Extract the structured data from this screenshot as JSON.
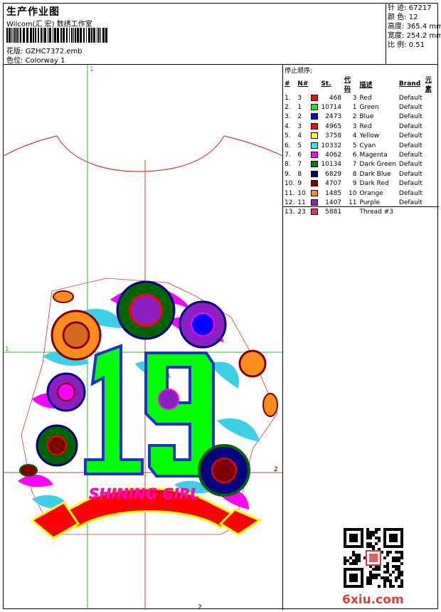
{
  "header": {
    "title": "生产作业图",
    "company": "Wilcom(汇 宏) 数绣工作室",
    "design_label": "花版:",
    "design_value": "GZHC7372.emb",
    "colorway_label": "色位:",
    "colorway_value": "Colorway 1"
  },
  "stats": [
    {
      "label": "针 迹:",
      "value": "67217"
    },
    {
      "label": "颜 色:",
      "value": "12"
    },
    {
      "label": "高度:",
      "value": "365.4 mm"
    },
    {
      "label": "宽度:",
      "value": "254.2 mm"
    },
    {
      "label": "比 例:",
      "value": "0.51"
    }
  ],
  "stop_sequence": {
    "title": "停止顺序:",
    "columns": [
      "#",
      "N#",
      "St.",
      "代码",
      "描述",
      "Brand",
      "元素"
    ],
    "rows": [
      {
        "idx": "1.",
        "n": "3",
        "color": "#ff0000",
        "st": "468",
        "code": "3",
        "desc": "Red",
        "brand": "Default"
      },
      {
        "idx": "2.",
        "n": "1",
        "color": "#00ff00",
        "st": "10714",
        "code": "1",
        "desc": "Green",
        "brand": "Default"
      },
      {
        "idx": "3.",
        "n": "2",
        "color": "#0000ff",
        "st": "2473",
        "code": "2",
        "desc": "Blue",
        "brand": "Default"
      },
      {
        "idx": "4.",
        "n": "3",
        "color": "#ff0000",
        "st": "4965",
        "code": "3",
        "desc": "Red",
        "brand": "Default"
      },
      {
        "idx": "5.",
        "n": "4",
        "color": "#ffff00",
        "st": "3758",
        "code": "4",
        "desc": "Yellow",
        "brand": "Default"
      },
      {
        "idx": "6.",
        "n": "5",
        "color": "#00ffff",
        "st": "10332",
        "code": "5",
        "desc": "Cyan",
        "brand": "Default"
      },
      {
        "idx": "7.",
        "n": "6",
        "color": "#ff00ff",
        "st": "4062",
        "code": "6",
        "desc": "Magenta",
        "brand": "Default"
      },
      {
        "idx": "8.",
        "n": "7",
        "color": "#008000",
        "st": "10134",
        "code": "7",
        "desc": "Dark Green",
        "brand": "Default"
      },
      {
        "idx": "9.",
        "n": "8",
        "color": "#000080",
        "st": "6829",
        "code": "8",
        "desc": "Dark Blue",
        "brand": "Default"
      },
      {
        "idx": "10.",
        "n": "9",
        "color": "#800000",
        "st": "4707",
        "code": "9",
        "desc": "Dark Red",
        "brand": "Default"
      },
      {
        "idx": "11.",
        "n": "10",
        "color": "#ff8c1a",
        "st": "1485",
        "code": "10",
        "desc": "Orange",
        "brand": "Default"
      },
      {
        "idx": "12.",
        "n": "11",
        "color": "#8b1fbf",
        "st": "1407",
        "code": "11",
        "desc": "Purple",
        "brand": "Default"
      },
      {
        "idx": "13.",
        "n": "23",
        "color": "#d63a6a",
        "st": "5881",
        "code": "",
        "desc": "Thread #3",
        "brand": ""
      }
    ]
  },
  "artwork": {
    "number_text": "19",
    "banner_text": "SHINING GIRL",
    "guide_labels": {
      "top": "1",
      "left": "1",
      "right": "2",
      "bottom": "2"
    }
  },
  "watermark": "6xiu.com"
}
